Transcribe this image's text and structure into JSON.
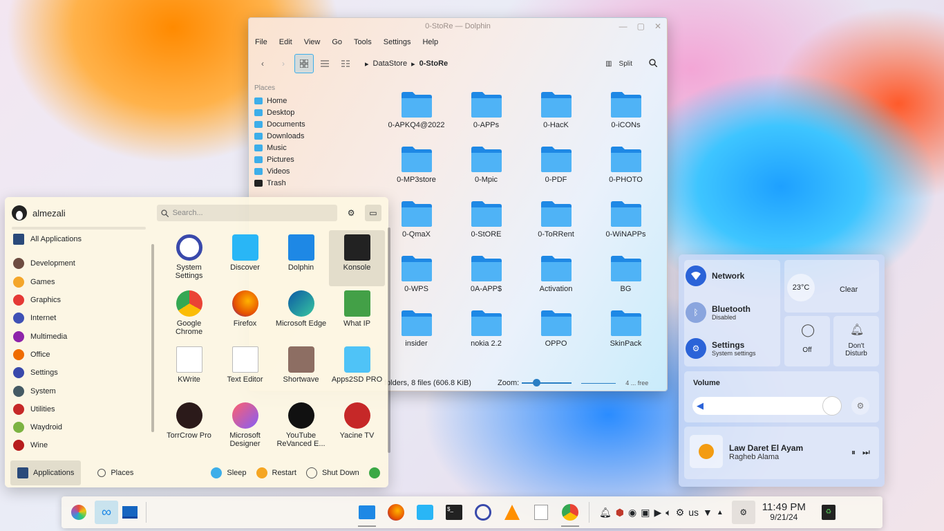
{
  "dolphin": {
    "title": "0-StoRe — Dolphin",
    "menu": [
      "File",
      "Edit",
      "View",
      "Go",
      "Tools",
      "Settings",
      "Help"
    ],
    "breadcrumb": [
      "DataStore",
      "0-StoRe"
    ],
    "split_label": "Split",
    "places_heading": "Places",
    "places": [
      "Home",
      "Desktop",
      "Documents",
      "Downloads",
      "Music",
      "Pictures",
      "Videos",
      "Trash"
    ],
    "files": [
      "0-APKQ4@2022",
      "0-APPs",
      "0-HacK",
      "0-iCONs",
      "0-MP3store",
      "0-Mpic",
      "0-PDF",
      "0-PHOTO",
      "0-QmaX",
      "0-StORE",
      "0-ToRRent",
      "0-WiNAPPs",
      "0-WPS",
      "0A-APP$",
      "Activation",
      "BG",
      "insider",
      "nokia 2.2",
      "OPPO",
      "SkinPack"
    ],
    "status": "folders, 8 files (606.8 KiB)",
    "zoom_label": "Zoom:",
    "free_space": "4 ... free"
  },
  "kickoff": {
    "username": "almezali",
    "search_placeholder": "Search...",
    "all_apps": "All Applications",
    "categories": [
      "Development",
      "Games",
      "Graphics",
      "Internet",
      "Multimedia",
      "Office",
      "Settings",
      "System",
      "Utilities",
      "Waydroid",
      "Wine"
    ],
    "apps": [
      [
        "System",
        "Settings"
      ],
      [
        "Discover",
        ""
      ],
      [
        "Dolphin",
        ""
      ],
      [
        "Konsole",
        ""
      ],
      [
        "Google",
        "Chrome"
      ],
      [
        "Firefox",
        ""
      ],
      [
        "Microsoft Edge",
        ""
      ],
      [
        "What IP",
        ""
      ],
      [
        "KWrite",
        ""
      ],
      [
        "Text Editor",
        ""
      ],
      [
        "Shortwave",
        ""
      ],
      [
        "Apps2SD PRO",
        ""
      ],
      [
        "TorrCrow Pro",
        ""
      ],
      [
        "Microsoft",
        "Designer"
      ],
      [
        "YouTube",
        "ReVanced E..."
      ],
      [
        "Yacine TV",
        ""
      ]
    ],
    "footer": {
      "applications": "Applications",
      "places": "Places",
      "sleep": "Sleep",
      "restart": "Restart",
      "shutdown": "Shut Down"
    }
  },
  "quick_settings": {
    "network": "Network",
    "bluetooth": "Bluetooth",
    "bluetooth_state": "Disabled",
    "settings": "Settings",
    "settings_sub": "System settings",
    "temp": "23°C",
    "weather": "Clear",
    "night_light": "Off",
    "dnd": [
      "Don't",
      "Disturb"
    ],
    "volume_label": "Volume",
    "volume_level": 0.94,
    "song": "Law Daret El Ayam",
    "artist": "Ragheb Alama"
  },
  "panel": {
    "kb_layout": "us",
    "time": "11:49 PM",
    "date": "9/21/24"
  }
}
